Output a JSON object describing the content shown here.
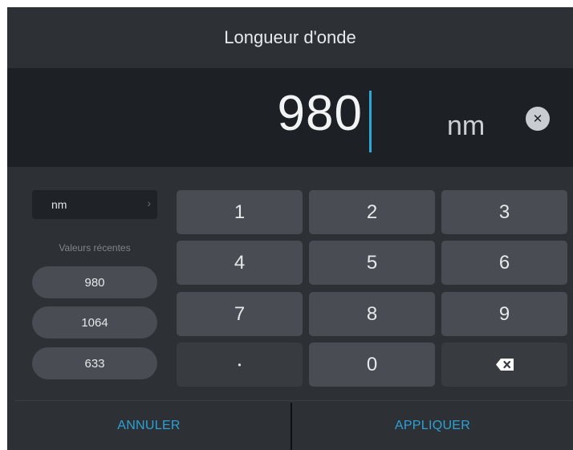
{
  "dialog": {
    "title": "Longueur d'onde"
  },
  "display": {
    "value": "980",
    "unit": "nm",
    "clear_icon": "close-icon",
    "clear_glyph": "✕"
  },
  "unit_selector": {
    "selected": "nm",
    "chevron_glyph": "›"
  },
  "recent": {
    "title": "Valeurs récentes",
    "values": [
      "980",
      "1064",
      "633"
    ]
  },
  "keypad": {
    "keys": [
      "1",
      "2",
      "3",
      "4",
      "5",
      "6",
      "7",
      "8",
      "9",
      "•",
      "0"
    ],
    "backspace_icon": "backspace-icon"
  },
  "footer": {
    "cancel_label": "ANNULER",
    "apply_label": "APPLIQUER"
  },
  "colors": {
    "accent": "#2ca2d6",
    "background": "#2d3035",
    "display_background": "#1d2024",
    "key": "#494c53"
  }
}
